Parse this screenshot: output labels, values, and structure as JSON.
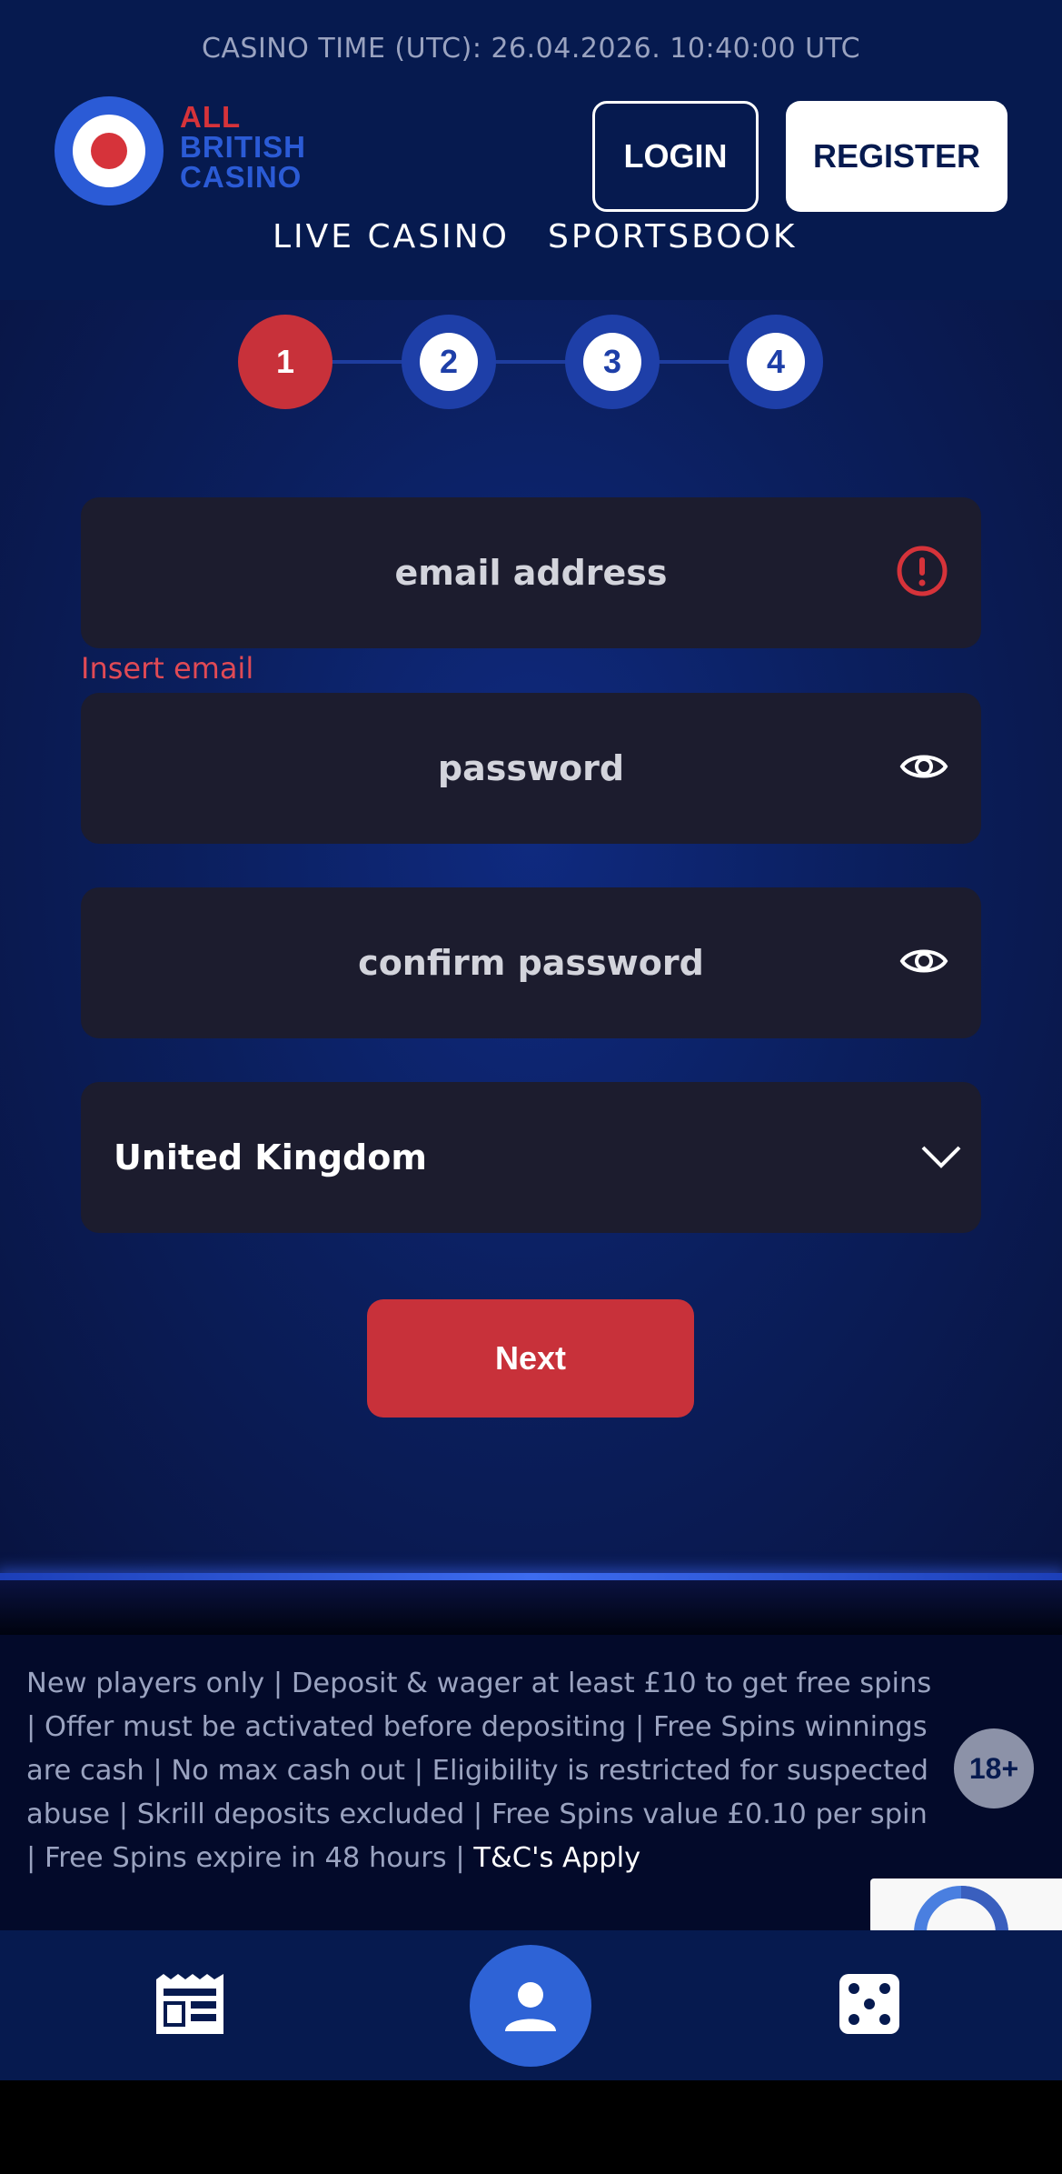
{
  "header": {
    "casino_time": "CASINO TIME (UTC): 26.04.2026. 10:40:00 UTC",
    "logo": {
      "line1": "ALL",
      "line2": "BRITISH",
      "line3": "CASINO"
    },
    "login_label": "LOGIN",
    "register_label": "REGISTER",
    "nav": [
      {
        "label": "LIVE CASINO"
      },
      {
        "label": "SPORTSBOOK"
      }
    ]
  },
  "steps": {
    "items": [
      "1",
      "2",
      "3",
      "4"
    ],
    "active": "1"
  },
  "form": {
    "email_placeholder": "email address",
    "email_error": "Insert email",
    "password_placeholder": "password",
    "confirm_placeholder": "confirm password",
    "country_value": "United Kingdom",
    "next_label": "Next"
  },
  "disclaimer": {
    "text": "New players only | Deposit & wager at least £10 to get free spins | Offer must be activated before depositing | Free Spins winnings are cash | No max cash out | Eligibility is restricted for suspected abuse | Skrill deposits excluded | Free Spins value £0.10 per spin | Free Spins expire in 48 hours | ",
    "tc_link": "T&C's Apply",
    "age_badge": "18+"
  },
  "colors": {
    "header_bg": "#061a4f",
    "accent_red": "#c8313a",
    "accent_blue": "#2e63d6",
    "field_bg": "#1c1c2e"
  },
  "icons": {
    "email_status": "alert-circle-icon",
    "password_toggle": "eye-icon",
    "confirm_toggle": "eye-icon",
    "country_chevron": "chevron-down-icon",
    "bottom_nav": [
      "news-icon",
      "profile-icon",
      "dice-icon"
    ]
  }
}
